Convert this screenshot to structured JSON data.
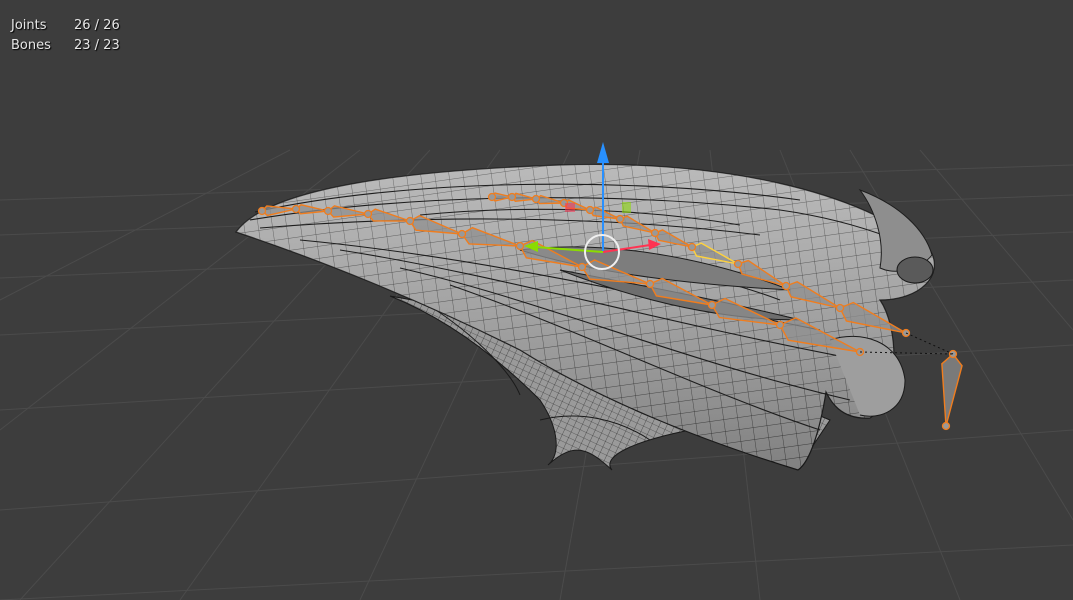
{
  "stats": {
    "joints_label": "Joints",
    "joints_value": "26 / 26",
    "bones_label": "Bones",
    "bones_value": "23 / 23"
  },
  "colors": {
    "background": "#3d3d3d",
    "grid": "#4a4a4a",
    "mesh_fill": "#a9a9a9",
    "mesh_wire": "#1e1e1e",
    "bone_select": "#f07d1e",
    "bone_active": "#ffd23c",
    "gizmo_x": "#ff3352",
    "gizmo_y": "#8bdc00",
    "gizmo_z": "#2890ff"
  }
}
